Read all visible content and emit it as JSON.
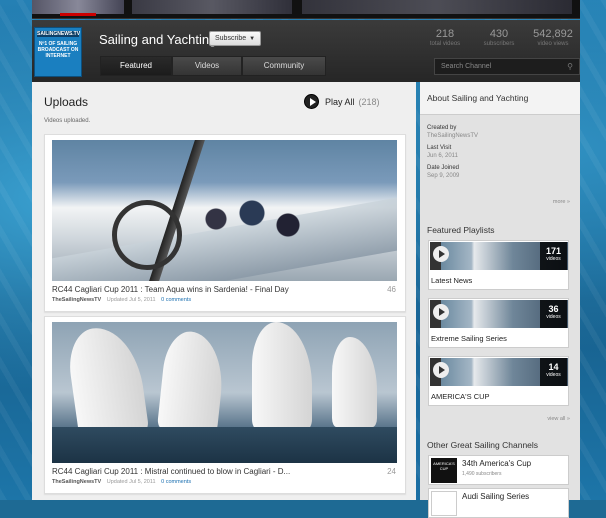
{
  "channel": {
    "title": "Sailing and Yachting",
    "subscribe_label": "Subscribe",
    "logo_line1": "SAILINGNEWS.TV",
    "logo_line2": "Nº1 OF SAILING BROADCAST ON INTERNET",
    "stats": [
      {
        "value": "218",
        "label": "total videos"
      },
      {
        "value": "430",
        "label": "subscribers"
      },
      {
        "value": "542,892",
        "label": "video views"
      }
    ],
    "tabs": [
      "Featured",
      "Videos",
      "Community"
    ],
    "active_tab": "Featured",
    "search_placeholder": "Search Channel"
  },
  "uploads": {
    "title": "Uploads",
    "play_all": "Play All",
    "count": "(218)",
    "subtitle": "Videos uploaded.",
    "videos": [
      {
        "title": "RC44 Cagliari Cup 2011 : Team Aqua wins in Sardenia! - Final Day",
        "number": "46",
        "channel": "TheSailingNewsTV",
        "uploaded": "Updated Jul 5, 2011",
        "comments": "0 comments"
      },
      {
        "title": "RC44 Cagliari Cup 2011 : Mistral continued to blow in Cagliari - D...",
        "number": "24",
        "channel": "TheSailingNewsTV",
        "uploaded": "Updated Jul 5, 2011",
        "comments": "0 comments"
      }
    ]
  },
  "about": {
    "heading": "About Sailing and Yachting",
    "created_by_label": "Created by",
    "created_by": "TheSailingNewsTV",
    "last_visit_label": "Last Visit",
    "last_visit": "Jun 6, 2011",
    "date_joined_label": "Date Joined",
    "date_joined": "Sep 9, 2009",
    "more": "more »"
  },
  "playlists": {
    "heading": "Featured Playlists",
    "items": [
      {
        "name": "Latest News",
        "count": "171",
        "unit": "videos"
      },
      {
        "name": "Extreme Sailing Series",
        "count": "36",
        "unit": "videos"
      },
      {
        "name": "AMERICA'S CUP",
        "count": "14",
        "unit": "videos"
      }
    ],
    "view_all": "view all »"
  },
  "other_channels": {
    "heading": "Other Great Sailing Channels",
    "items": [
      {
        "name": "34th America's Cup",
        "subs": "1,490 subscribers",
        "avatar_text": "AMERICA'S CUP"
      },
      {
        "name": "Audi Sailing Series",
        "subs": "",
        "avatar_text": ""
      }
    ]
  }
}
